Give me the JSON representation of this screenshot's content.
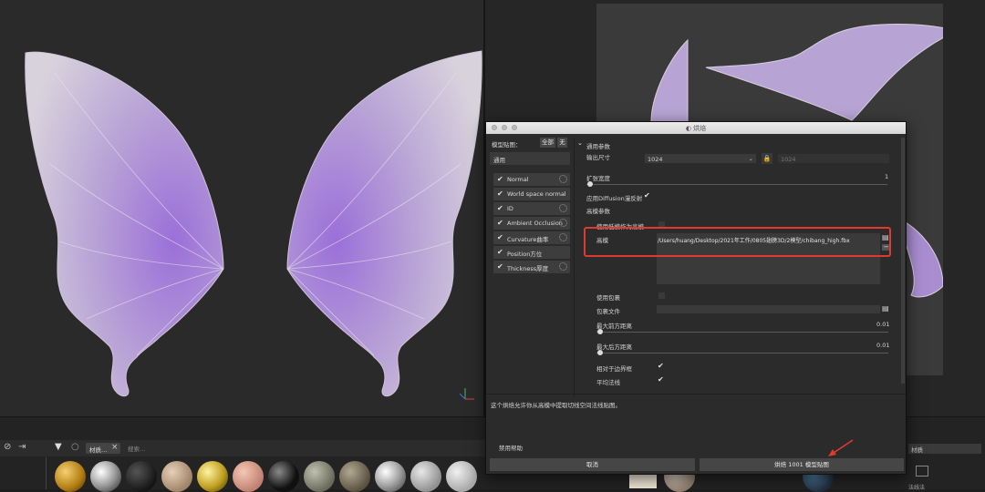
{
  "dialog": {
    "title": "烘焙",
    "map_panel": {
      "header": "模型贴图：",
      "all_btn": "全部",
      "none_btn": "无",
      "common_label": "通用",
      "maps": [
        {
          "label": "Normal"
        },
        {
          "label": "World space normal"
        },
        {
          "label": "ID"
        },
        {
          "label": "Ambient Occlusion"
        },
        {
          "label": "Curvature曲率"
        },
        {
          "label": "Position方位"
        },
        {
          "label": "Thickness厚度"
        }
      ]
    },
    "common_params": {
      "title": "通用参数",
      "output_size_label": "输出尺寸",
      "output_size_value": "1024",
      "output_size_locked": "1024",
      "dilation_label": "扩张宽度",
      "dilation_value": "1",
      "apply_diffusion_label": "应用Diffusion漫反射"
    },
    "high_poly_params": {
      "title": "高模参数",
      "use_low_as_high_label": "使用低模作为高模",
      "high_poly_label": "高模",
      "high_poly_path": "/Users/huang/Desktop/2021年工作/0805翅膀3D/2模型/chibang_high.fbx",
      "use_cage_label": "使用包裹",
      "cage_file_label": "包裹文件",
      "max_front_label": "最大前方距离",
      "max_front_value": "0.01",
      "max_rear_label": "最大后方距离",
      "max_rear_value": "0.01",
      "relative_bbox_label": "相对于边界框",
      "average_normals_label": "平均法线"
    },
    "description": "这个烘焙允许你从高模中提取切线空间法线贴图。",
    "disable_help": "禁用帮助",
    "cancel_btn": "取消",
    "bake_btn": "烘焙 1001 模型贴图"
  },
  "shelf": {
    "filter_tag": "材质…",
    "search_placeholder": "搜索…",
    "right_field": "材质",
    "right_bottom": "法线法"
  },
  "colors": {
    "highlight_box": "#e03a2e",
    "arrow": "#e03a2e",
    "wing": "#b9a6d6"
  }
}
